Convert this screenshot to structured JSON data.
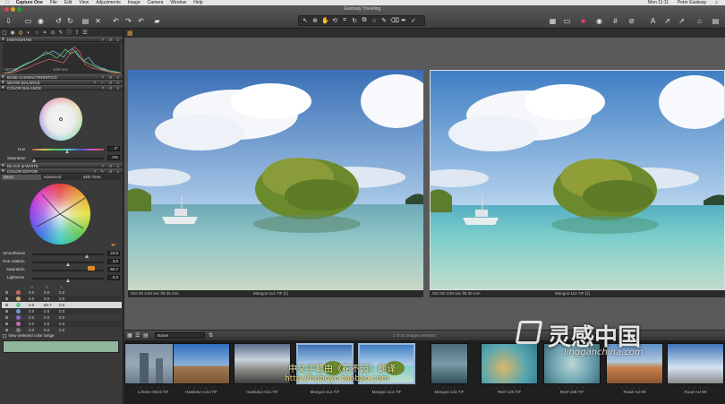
{
  "menubar": {
    "app": "Capture One",
    "items": [
      "File",
      "Edit",
      "View",
      "Adjustments",
      "Image",
      "Camera",
      "Window",
      "Help"
    ],
    "clock": "Mon 11:11",
    "user": "Peter Eastway"
  },
  "window": {
    "title": "Eastway Traveling"
  },
  "panels": {
    "histogram": "HISTOGRAM",
    "histogram_info": "ISO 50",
    "histogram_info2": "1/40 sec",
    "histogram_info3": "f/8",
    "base": "BASE CHARACTERISTICS",
    "white_balance": "WHITE BALANCE",
    "color_balance": "COLOR BALANCE",
    "hue_label": "Hue",
    "hue_value": "0°",
    "saturation_label": "Saturation",
    "saturation_value": "0%",
    "black_white": "BLACK & WHITE",
    "color_editor": "COLOR EDITOR",
    "ce_tabs": [
      "Basic",
      "Advanced",
      "Skin Tone"
    ],
    "smoothness_label": "Smoothness",
    "smoothness_value": "22.9",
    "hue_rotation_label": "Hue rotation",
    "hue_rotation_value": "3.0",
    "ce_saturation_label": "Saturation",
    "ce_saturation_value": "60.7",
    "lightness_label": "Lightness",
    "lightness_value": "0.0",
    "table_headers": [
      "H",
      "S",
      "L"
    ],
    "table_rows": [
      [
        "0.0",
        "0.0",
        "0.0"
      ],
      [
        "0.0",
        "0.0",
        "0.0"
      ],
      [
        "0.0",
        "60.7",
        "0.0"
      ],
      [
        "0.0",
        "0.0",
        "0.0"
      ],
      [
        "0.0",
        "0.0",
        "0.0"
      ],
      [
        "0.0",
        "0.0",
        "0.0"
      ],
      [
        "0.0",
        "0.0",
        "0.0"
      ]
    ],
    "view_selected": "View selected color range"
  },
  "viewer": {
    "left_info": "ISO 50   1/40 sec   f/8   35 mm",
    "left_name": "Mangos-114.TIF [1]",
    "right_info": "ISO 50   1/40 sec   f/8   35 mm",
    "right_name": "Mangos-114.TIF [2]"
  },
  "filmstrip": {
    "sort": "Name",
    "status": "1 of 31 images selected",
    "thumbs": [
      {
        "name": "Lofoten-0023.TIF"
      },
      {
        "name": "Hawkdun-144.TIF"
      },
      {
        "name": "Hawkdun-022.TIF"
      },
      {
        "name": "Mangos-114.TIF"
      },
      {
        "name": "Mangos-114.TIF"
      },
      {
        "name": "Mangos-122.TIF"
      },
      {
        "name": "Reef-130.TIF"
      },
      {
        "name": "Reef-168.TIF"
      },
      {
        "name": "Road-AU-09"
      },
      {
        "name": "Road-AU-99"
      }
    ]
  },
  "watermark": {
    "line1": "中文字幕由《花不园》翻译",
    "line2": "http://hoboyo.taobao.com",
    "brand_cn": "灵感中国",
    "brand_url": "lingganchina.com"
  }
}
